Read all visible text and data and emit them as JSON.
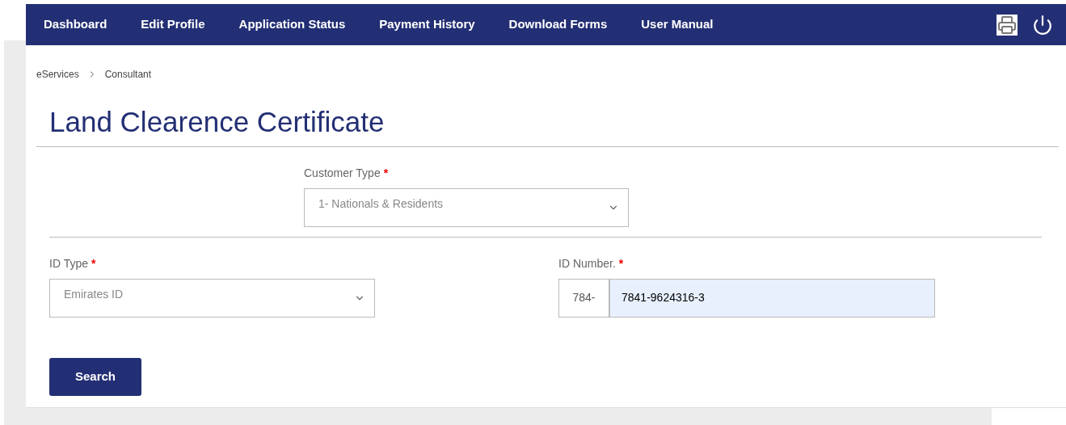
{
  "nav": {
    "items": [
      {
        "label": "Dashboard"
      },
      {
        "label": "Edit Profile"
      },
      {
        "label": "Application Status"
      },
      {
        "label": "Payment History"
      },
      {
        "label": "Download Forms"
      },
      {
        "label": "User Manual"
      }
    ]
  },
  "breadcrumb": [
    "eServices",
    "Consultant"
  ],
  "title": "Land Clearence Certificate",
  "customer_type": {
    "label": "Customer Type",
    "required_mark": "*",
    "value": "1-  Nationals & Residents"
  },
  "id_type": {
    "label": "ID Type",
    "required_mark": "*",
    "value": "Emirates ID"
  },
  "id_number": {
    "label": "ID Number.",
    "required_mark": "*",
    "prefix": "784-",
    "value": "7841-9624316-3"
  },
  "search_button": "Search"
}
